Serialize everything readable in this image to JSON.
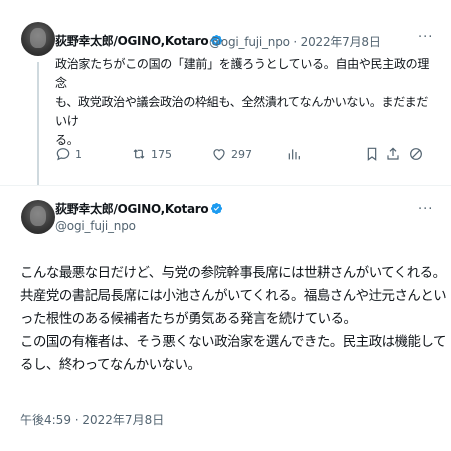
{
  "tweet1": {
    "name": "荻野幸太郎/OGINO,Kotaro",
    "handle": "@ogi_fuji_npo",
    "separator": "·",
    "date": "2022年7月8日",
    "more_label": "···",
    "text_lines": [
      "政治家たちがこの国の「建前」を護ろうとしている。自由や民主政の理念",
      "も、政党政治や議会政治の枠組も、全然潰れてなんかいない。まだまだいけ",
      "る。"
    ],
    "actions": {
      "reply_count": "1",
      "retweet_count": "175",
      "like_count": "297"
    }
  },
  "tweet2": {
    "name": "荻野幸太郎/OGINO,Kotaro",
    "handle": "@ogi_fuji_npo",
    "more_label": "···",
    "text_lines": [
      "こんな最悪な日だけど、与党の参院幹事長席には世耕さんがいてくれる。",
      "共産党の書記局長席には小池さんがいてくれる。福島さんや辻元さんとい",
      "った根性のある候補者たちが勇気ある発言を続けている。",
      "この国の有権者は、そう悪くない政治家を選んできた。民主政は機能して",
      "るし、終わってなんかいない。"
    ],
    "timestamp": "午後4:59 · 2022年7月8日"
  },
  "colors": {
    "verified_blue": "#1d9bf0",
    "secondary_text": "#536471",
    "primary_text": "#0f1419"
  },
  "icons": [
    "verified-badge-icon",
    "reply-icon",
    "retweet-icon",
    "like-icon",
    "views-icon",
    "bookmark-icon",
    "share-icon",
    "block-icon"
  ]
}
